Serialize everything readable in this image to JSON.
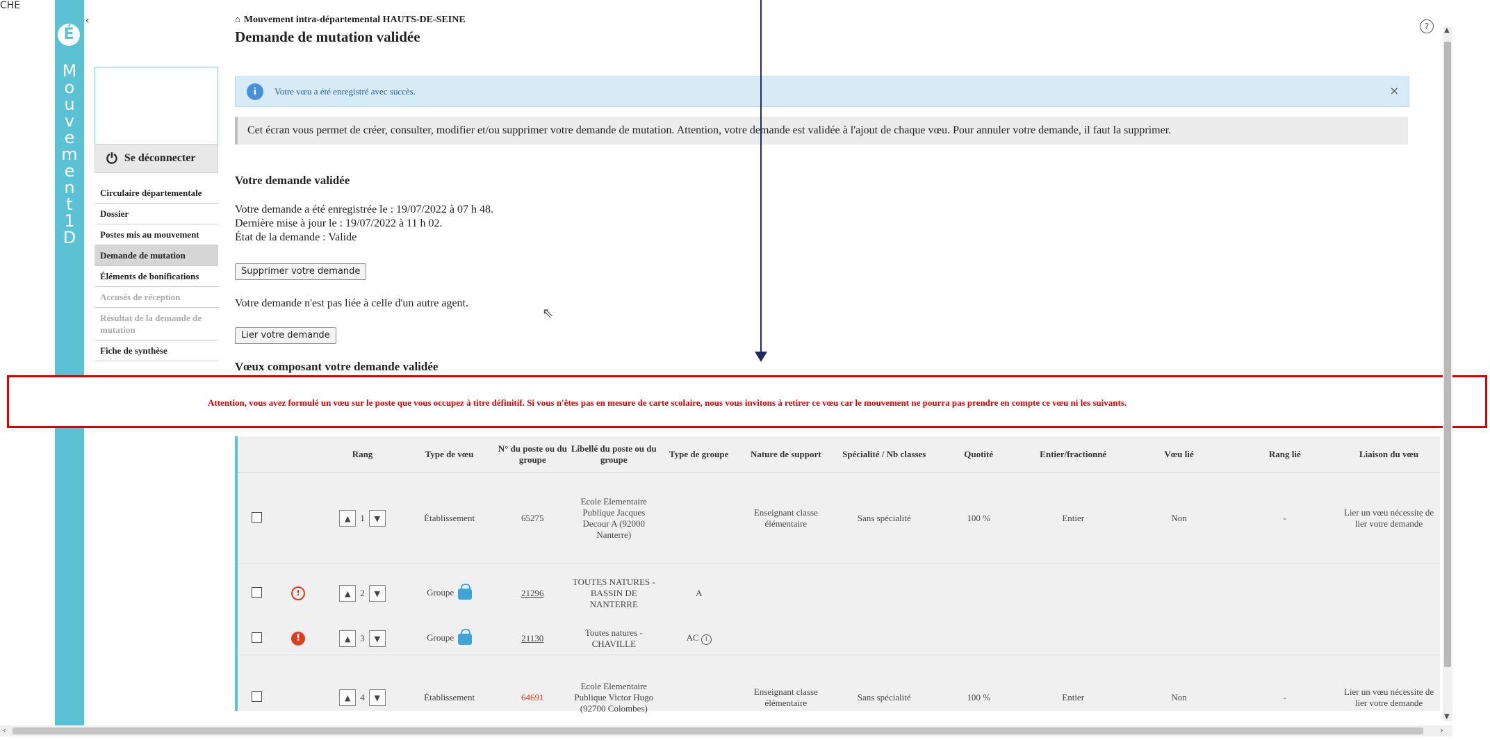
{
  "corner_label": "CHE",
  "brand": {
    "logo": "É",
    "letters": [
      "M",
      "o",
      "u",
      "v",
      "e",
      "m",
      "e",
      "n",
      "t",
      " ",
      "1",
      "D"
    ]
  },
  "collapse_icon": "‹",
  "sidebar": {
    "logout_label": "Se déconnecter",
    "items": [
      {
        "label": "Circulaire départementale",
        "state": "normal"
      },
      {
        "label": "Dossier",
        "state": "normal"
      },
      {
        "label": "Postes mis au mouvement",
        "state": "normal"
      },
      {
        "label": "Demande de mutation",
        "state": "active"
      },
      {
        "label": "Éléments de bonifications",
        "state": "normal"
      },
      {
        "label": "Accusés de réception",
        "state": "disabled"
      },
      {
        "label": "Résultat de la demande de mutation",
        "state": "disabled"
      },
      {
        "label": "Fiche de synthèse",
        "state": "normal"
      }
    ]
  },
  "header": {
    "breadcrumb": "Mouvement intra-départemental HAUTS-DE-SEINE",
    "title": "Demande de mutation validée"
  },
  "success_alert": "Votre vœu a été enregistré avec succès.",
  "notice": "Cet écran vous permet de créer, consulter, modifier et/ou supprimer votre demande de mutation. Attention, votre demande est validée à l'ajout de chaque vœu. Pour annuler votre demande, il faut la supprimer.",
  "section1": {
    "title": "Votre demande validée",
    "line1": "Votre demande a été enregistrée le : 19/07/2022 à 07 h 48.",
    "line2": "Dernière mise à jour le : 19/07/2022 à 11 h 02.",
    "line3": "État de la demande : Valide"
  },
  "delete_button": "Supprimer votre demande",
  "not_linked_text": "Votre demande n'est pas liée à celle d'un autre agent.",
  "link_button": "Lier votre demande",
  "section2_title": "Vœux composant votre demande validée",
  "warning": "Attention, vous avez formulé un vœu sur le poste que vous occupez à titre définitif. Si vous n'êtes pas en mesure de carte scolaire, nous vous invitons à retirer ce vœu car le mouvement ne pourra pas prendre en compte ce vœu ni les suivants.",
  "table": {
    "headers": [
      "Rang",
      "Type de vœu",
      "N° du poste ou du groupe",
      "Libellé du poste ou du groupe",
      "Type de groupe",
      "Nature de support",
      "Spécialité / Nb classes",
      "Quotité",
      "Entier/fractionné",
      "Vœu lié",
      "Rang lié",
      "Liaison du vœu"
    ],
    "rows": [
      {
        "rank": "1",
        "type": "Établissement",
        "num": "65275",
        "libelle": "Ecole Elementaire Publique Jacques Decour A (92000 Nanterre)",
        "group_type": "",
        "nature": "Enseignant classe élémentaire",
        "specialite": "Sans spécialité",
        "quotite": "100 %",
        "entier": "Entier",
        "voeu_lie": "Non",
        "rang_lie": "-",
        "liaison": "Lier un vœu nécessite de lier votre demande"
      },
      {
        "rank": "2",
        "type": "Groupe",
        "num": "21296",
        "libelle": "TOUTES NATURES - BASSIN DE NANTERRE",
        "group_type": "A",
        "nature": "",
        "specialite": "",
        "quotite": "",
        "entier": "",
        "voeu_lie": "",
        "rang_lie": "",
        "liaison": ""
      },
      {
        "rank": "3",
        "type": "Groupe",
        "num": "21130",
        "libelle": "Toutes natures - CHAVILLE",
        "group_type": "AC",
        "nature": "",
        "specialite": "",
        "quotite": "",
        "entier": "",
        "voeu_lie": "",
        "rang_lie": "",
        "liaison": ""
      },
      {
        "rank": "4",
        "type": "Établissement",
        "num": "64691",
        "libelle": "Ecole Elementaire Publique Victor Hugo (92700 Colombes)",
        "group_type": "",
        "nature": "Enseignant classe élémentaire",
        "specialite": "Sans spécialité",
        "quotite": "100 %",
        "entier": "Entier",
        "voeu_lie": "Non",
        "rang_lie": "-",
        "liaison": "Lier un vœu nécessite de lier votre demande"
      }
    ]
  },
  "colors": {
    "brand": "#5bc2d6",
    "warning": "#e00000",
    "arrow": "#1f2d5c",
    "warn_icon": "#e03c1e"
  }
}
